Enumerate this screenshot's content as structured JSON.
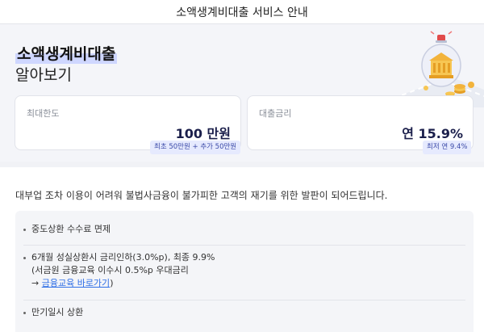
{
  "header": {
    "title": "소액생계비대출 서비스 안내"
  },
  "hero": {
    "title": "소액생계비대출",
    "subtitle": "알아보기"
  },
  "cards": {
    "limit": {
      "label": "최대한도",
      "value": "100 만원",
      "chip": "최초 50만원 + 추가 50만원"
    },
    "rate": {
      "label": "대출금리",
      "value": "연 15.9%",
      "chip": "최저 연 9.4%"
    }
  },
  "intro": "대부업 조차 이용이 어려워 불법사금융이 불가피한 고객의 재기를 위한 발판이 되어드립니다.",
  "features": {
    "item1": "중도상환 수수료 면제",
    "item2": {
      "line1": "6개월 성실상환시 금리인하(3.0%p), 최종 9.9%",
      "line2": "(서금원 금융교육 이수시 0.5%p 우대금리",
      "arrow": "→ ",
      "link": "금융교육 바로가기",
      "close": ")"
    },
    "item3": "만기일시 상환"
  },
  "colors": {
    "accent": "#cfd7ff",
    "value_text": "#1b1f4b",
    "chip_bg": "#e6eafe",
    "link": "#2f6fe6"
  },
  "icons": {
    "illustration": "bank-coins-illustration"
  }
}
